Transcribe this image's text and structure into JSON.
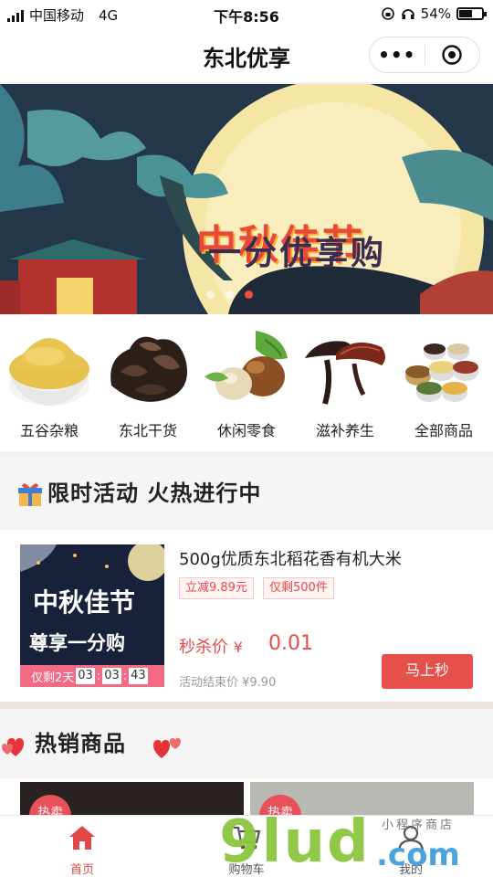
{
  "status_bar": {
    "carrier": "中国移动",
    "network": "4G",
    "time": "下午8:56",
    "battery": "54%",
    "battery_level": 0.54
  },
  "header": {
    "title": "东北优享",
    "menu_glyph": "•••"
  },
  "banner": {
    "headline": "中秋佳节",
    "subline": "一分优享购",
    "slide_count": 3,
    "active_slide": 3
  },
  "categories": [
    {
      "label": "五谷杂粮",
      "icon": "millet-bowl"
    },
    {
      "label": "东北干货",
      "icon": "black-fungus"
    },
    {
      "label": "休闲零食",
      "icon": "hazelnuts"
    },
    {
      "label": "滋补养生",
      "icon": "lingzhi-mushroom"
    },
    {
      "label": "全部商品",
      "icon": "grain-assortment"
    }
  ],
  "flash_sale": {
    "section_title": "限时活动 火热进行中",
    "product": {
      "name": "500g优质东北稻花香有机大米",
      "tag_discount": "立减9.89元",
      "tag_stock": "仅剩500件",
      "price_label": "秒杀价",
      "currency": "¥",
      "price": "0.01",
      "end_price_label": "活动结束价 ¥9.90",
      "buy_button": "马上秒",
      "image_line1": "中秋佳节",
      "image_line2": "尊享一分购",
      "countdown_prefix": "仅剩2天",
      "countdown_h": "03",
      "countdown_m": "03",
      "countdown_s": "43"
    }
  },
  "hot": {
    "section_title": "热销商品",
    "badge_left": "热卖",
    "badge_right": "热卖"
  },
  "tabbar": [
    {
      "label": "首页",
      "icon": "home-icon",
      "active": true
    },
    {
      "label": "购物车",
      "icon": "cart-icon",
      "active": false
    },
    {
      "label": "我的",
      "icon": "user-icon",
      "active": false
    }
  ],
  "watermark": {
    "main": "9lud",
    "suffix": ".com",
    "caption": "小程序商店"
  },
  "colors": {
    "accent": "#e6504b",
    "price": "#e84b4b",
    "banner_bg": "#243446",
    "moon": "#f7e9b0"
  }
}
